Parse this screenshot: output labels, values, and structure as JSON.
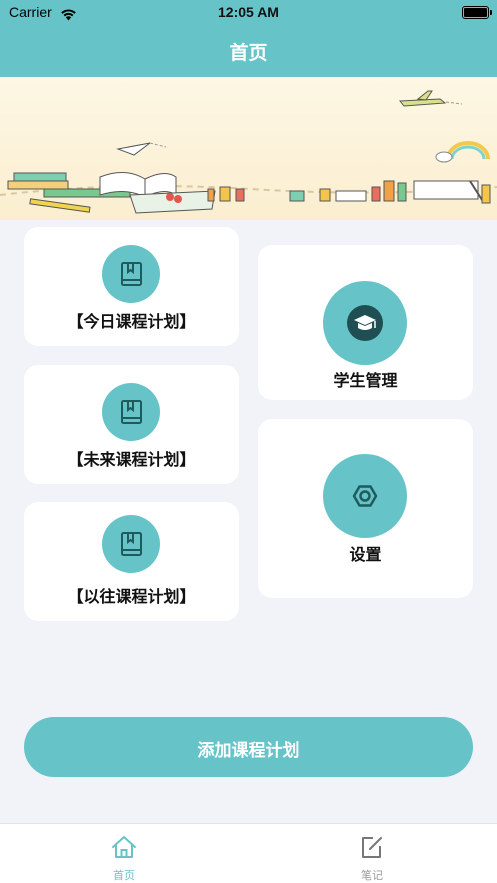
{
  "status_bar": {
    "carrier": "Carrier",
    "time": "12:05 AM"
  },
  "nav": {
    "title": "首页"
  },
  "cards": {
    "today": {
      "label": "【今日课程计划】",
      "icon": "book-icon"
    },
    "future": {
      "label": "【未来课程计划】",
      "icon": "book-icon"
    },
    "past": {
      "label": "【以往课程计划】",
      "icon": "book-icon"
    },
    "students": {
      "label": "学生管理",
      "icon": "graduation-cap-icon"
    },
    "settings": {
      "label": "设置",
      "icon": "hexagon-nut-icon"
    }
  },
  "add_button": {
    "label": "添加课程计划"
  },
  "tab_bar": {
    "tabs": [
      {
        "label": "首页",
        "icon": "home-icon",
        "active": true
      },
      {
        "label": "笔记",
        "icon": "edit-icon",
        "active": false
      }
    ]
  },
  "colors": {
    "accent": "#66c4c9",
    "background": "#f1f3f8",
    "inactive": "#9a9a9a"
  }
}
